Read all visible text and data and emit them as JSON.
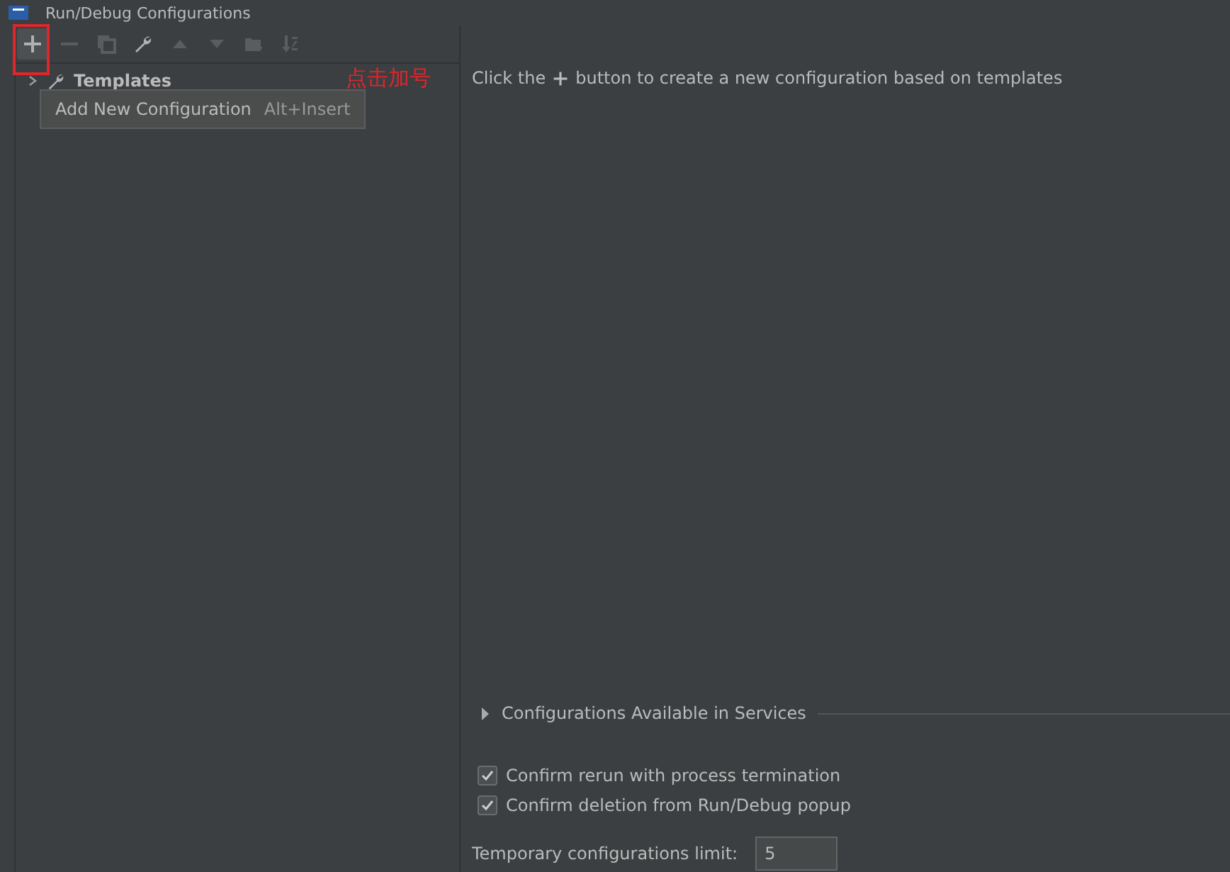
{
  "window": {
    "title": "Run/Debug Configurations"
  },
  "toolbar": [
    {
      "kind": "add",
      "disabled": false,
      "highlighted": true
    },
    {
      "kind": "remove",
      "disabled": true,
      "highlighted": false
    },
    {
      "kind": "copy",
      "disabled": true,
      "highlighted": false
    },
    {
      "kind": "wrench",
      "disabled": false,
      "highlighted": false
    },
    {
      "kind": "up",
      "disabled": true,
      "highlighted": false
    },
    {
      "kind": "down",
      "disabled": true,
      "highlighted": false
    },
    {
      "kind": "folder",
      "disabled": true,
      "highlighted": false
    },
    {
      "kind": "sort",
      "disabled": true,
      "highlighted": false
    }
  ],
  "annotation": "点击加号",
  "tree": [
    {
      "label": "Templates",
      "expanded": false
    }
  ],
  "tooltip": {
    "text": "Add New Configuration",
    "shortcut": "Alt+Insert"
  },
  "hint": {
    "before": "Click the",
    "after": "button to create a new configuration based on templates"
  },
  "services": {
    "label": "Configurations Available in Services",
    "expanded": false
  },
  "options": [
    {
      "label": "Confirm rerun with process termination",
      "checked": true
    },
    {
      "label": "Confirm deletion from Run/Debug popup",
      "checked": true
    }
  ],
  "limit": {
    "label": "Temporary configurations limit:",
    "value": "5"
  }
}
